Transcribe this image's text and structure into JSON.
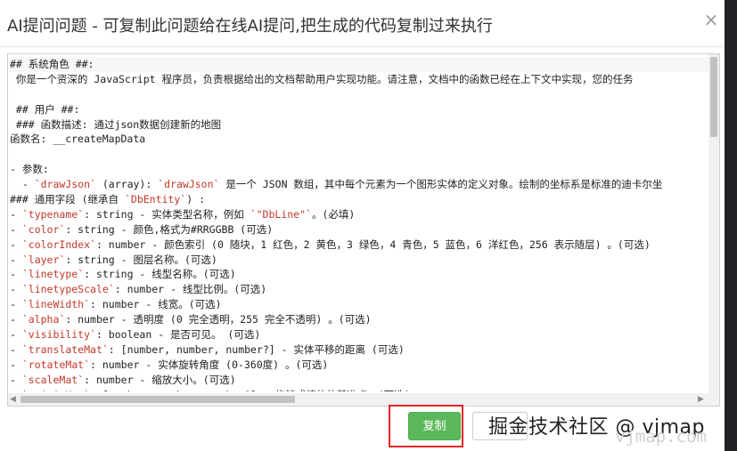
{
  "dialog": {
    "title": "AI提问问题 - 可复制此问题给在线AI提问,把生成的代码复制过来执行",
    "close_glyph": "×"
  },
  "code_lines": [
    "## 系统角色 ##:",
    " 你是一个资深的 JavaScript 程序员，负责根据给出的文档帮助用户实现功能。请注意，文档中的函数已经在上下文中实现，您的任务",
    "",
    " ## 用户 ##:",
    " ### 函数描述: 通过json数据创建新的地图",
    "函数名: __createMapData",
    "",
    "- 参数:",
    "  - `drawJson` (array): `drawJson` 是一个 JSON 数组，其中每个元素为一个图形实体的定义对象。绘制的坐标系是标准的迪卡尔坐",
    "### 通用字段 (继承自 `DbEntity`) :",
    "- `typename`: string - 实体类型名称，例如 `\"DbLine\"`。(必填)",
    "- `color`: string - 颜色,格式为#RRGGBB (可选)",
    "- `colorIndex`: number - 颜色索引 (0 随块，1 红色，2 黄色，3 绿色，4 青色，5 蓝色，6 洋红色，256 表示随层) 。(可选)",
    "- `layer`: string - 图层名称。(可选)",
    "- `linetype`: string - 线型名称。(可选)",
    "- `linetypeScale`: number - 线型比例。(可选)",
    "- `lineWidth`: number - 线宽。(可选)",
    "- `alpha`: number - 透明度 (0 完全透明，255 完全不透明) 。(可选)",
    "- `visibility`: boolean - 是否可见。 (可选)",
    "- `translateMat`: [number, number, number?] - 实体平移的距离 (可选)",
    "- `rotateMat`: number - 实体旋转角度 (0-360度) 。(可选)",
    "- `scaleMat`: number - 缩放大小。(可选)",
    "- `originMat`: [number, number, number?] - 旋转或缩放的基准点。(可选)"
  ],
  "buttons": {
    "copy_label": "复制"
  },
  "watermark": {
    "text": "掘金技术社区 @ vjmap",
    "subtext": "vjmap.com"
  },
  "colors": {
    "copy_button": "#5cb85c",
    "highlight_box": "#e32626"
  }
}
